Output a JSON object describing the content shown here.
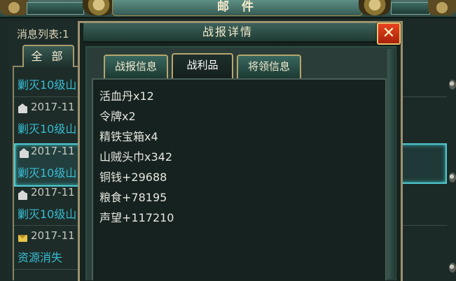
{
  "mail_header": {
    "title": "邮 件"
  },
  "message_list": {
    "label": "消息列表:1",
    "tab_all": "全 部",
    "items": [
      {
        "date": "",
        "subject": "剿灭10级山",
        "icon": "none"
      },
      {
        "date": "2017-11",
        "subject": "剿灭10级山",
        "icon": "envelope-open-icon"
      },
      {
        "date": "2017-11",
        "subject": "剿灭10级山",
        "icon": "envelope-open-icon",
        "selected": true
      },
      {
        "date": "2017-11",
        "subject": "剿灭10级山",
        "icon": "envelope-open-icon"
      },
      {
        "date": "2017-11",
        "subject": "资源消失",
        "icon": "envelope-new-icon"
      }
    ]
  },
  "dialog": {
    "title": "战报详情",
    "close_label": "✕",
    "tabs": [
      {
        "label": "战报信息",
        "active": false
      },
      {
        "label": "战利品",
        "active": true
      },
      {
        "label": "将领信息",
        "active": false
      }
    ],
    "loot": [
      "活血丹x12",
      "令牌x2",
      "精铁宝箱x4",
      "山贼头巾x342",
      "铜钱+29688",
      "粮食+78195",
      "声望+117210"
    ]
  },
  "colors": {
    "accent_cyan": "#38bcd3",
    "close_red": "#d2361a",
    "gold_border": "#b7a66c"
  }
}
